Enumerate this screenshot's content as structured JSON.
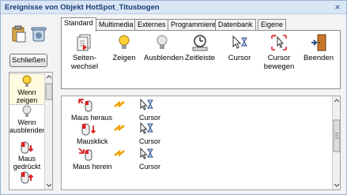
{
  "window": {
    "title": "Ereignisse von Objekt HotSpot_Titusbogen",
    "close_glyph": "×"
  },
  "toolbar": {
    "paste_icon": "paste-icon",
    "delete_icon": "trash-icon"
  },
  "schliessen_label": "Schließen",
  "event_list": [
    {
      "label": "Wenn zeigen",
      "icon": "lightbulb-on-icon"
    },
    {
      "label": "Wenn ausblenden",
      "icon": "lightbulb-off-icon"
    },
    {
      "label": "Maus gedrückt",
      "icon": "mouse-down-icon"
    },
    {
      "label": "",
      "icon": "mouse-up-icon"
    }
  ],
  "tabs": [
    "Standard",
    "Multimedia",
    "Externes",
    "Programmieren",
    "Datenbank",
    "Eigene"
  ],
  "active_tab": "Standard",
  "actions": [
    {
      "label": "Seiten-\nwechsel",
      "icon": "page-change-icon"
    },
    {
      "label": "Zeigen",
      "icon": "lightbulb-on-icon"
    },
    {
      "label": "Ausblenden",
      "icon": "lightbulb-off-icon"
    },
    {
      "label": "Zeitleiste",
      "icon": "timeline-icon"
    },
    {
      "label": "Cursor",
      "icon": "cursor-icon"
    },
    {
      "label": "Cursor\nbewegen",
      "icon": "cursor-move-icon"
    },
    {
      "label": "Beenden",
      "icon": "exit-door-icon"
    }
  ],
  "assignments": [
    {
      "event": "Maus heraus",
      "action": "Cursor"
    },
    {
      "event": "Mausklick",
      "action": "Cursor"
    },
    {
      "event": "Maus herein",
      "action": "Cursor"
    }
  ],
  "colors": {
    "accent": "#1b3a73",
    "titlebar": "#d8e6f6",
    "bolt": "#f0a000"
  }
}
